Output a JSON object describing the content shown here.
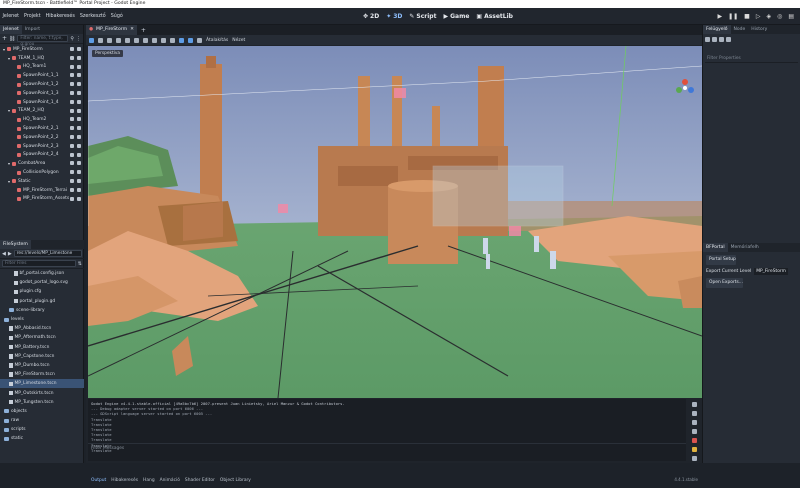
{
  "window": {
    "title": "MP_FireStorm.tscn - Battlefield™ Portal Project - Godot Engine"
  },
  "menu": {
    "items": [
      "Jelenet",
      "Projekt",
      "Hibakeresés",
      "Szerkesztő",
      "Súgó"
    ]
  },
  "main_buttons": {
    "b2d": "2D",
    "b3d": "3D",
    "script": "Script",
    "game": "Game",
    "assetlib": "AssetLib"
  },
  "left_dock": {
    "tabs": [
      "Jelenet",
      "Import"
    ],
    "filter_placeholder": "Filter: name, t:type, g:grou",
    "tree": [
      {
        "label": "MP_FireStorm",
        "depth": 0,
        "color": "#e06a6a"
      },
      {
        "label": "TEAM_1_HQ",
        "depth": 1,
        "color": "#e06a6a"
      },
      {
        "label": "HQ_Team1",
        "depth": 2,
        "color": "#e06a6a"
      },
      {
        "label": "SpawnPoint_1_1",
        "depth": 2,
        "color": "#e06a6a"
      },
      {
        "label": "SpawnPoint_1_2",
        "depth": 2,
        "color": "#e06a6a"
      },
      {
        "label": "SpawnPoint_1_3",
        "depth": 2,
        "color": "#e06a6a"
      },
      {
        "label": "SpawnPoint_1_4",
        "depth": 2,
        "color": "#e06a6a"
      },
      {
        "label": "TEAM_2_HQ",
        "depth": 1,
        "color": "#e06a6a"
      },
      {
        "label": "HQ_Team2",
        "depth": 2,
        "color": "#e06a6a"
      },
      {
        "label": "SpawnPoint_2_1",
        "depth": 2,
        "color": "#e06a6a"
      },
      {
        "label": "SpawnPoint_2_2",
        "depth": 2,
        "color": "#e06a6a"
      },
      {
        "label": "SpawnPoint_2_3",
        "depth": 2,
        "color": "#e06a6a"
      },
      {
        "label": "SpawnPoint_2_4",
        "depth": 2,
        "color": "#e06a6a"
      },
      {
        "label": "CombatArea",
        "depth": 1,
        "color": "#e06a6a"
      },
      {
        "label": "CollisionPolygon",
        "depth": 2,
        "color": "#e06a6a"
      },
      {
        "label": "Static",
        "depth": 1,
        "color": "#e06a6a"
      },
      {
        "label": "MP_FireStorm_Terrai",
        "depth": 2,
        "color": "#e06a6a"
      },
      {
        "label": "MP_FireStorm_Assets",
        "depth": 2,
        "color": "#e06a6a"
      }
    ],
    "filesystem_tab": "FileSystem",
    "path": "res://levels/MP_Limestone",
    "filter_files": "Filter Files",
    "files": [
      {
        "label": "bf_portal.config.json",
        "type": "file",
        "depth": 2,
        "sel": false
      },
      {
        "label": "godot_portal_logo.svg",
        "type": "file",
        "depth": 2,
        "sel": false
      },
      {
        "label": "plugin.cfg",
        "type": "file",
        "depth": 2,
        "sel": false
      },
      {
        "label": "portal_plugin.gd",
        "type": "file",
        "depth": 2,
        "sel": false
      },
      {
        "label": "scene-library",
        "type": "folder",
        "depth": 1,
        "sel": false
      },
      {
        "label": "levels",
        "type": "folder",
        "depth": 0,
        "sel": false
      },
      {
        "label": "MP_Abbasid.tscn",
        "type": "file",
        "depth": 1,
        "sel": false
      },
      {
        "label": "MP_Aftermath.tscn",
        "type": "file",
        "depth": 1,
        "sel": false
      },
      {
        "label": "MP_Battery.tscn",
        "type": "file",
        "depth": 1,
        "sel": false
      },
      {
        "label": "MP_Capstone.tscn",
        "type": "file",
        "depth": 1,
        "sel": false
      },
      {
        "label": "MP_Dumbo.tscn",
        "type": "file",
        "depth": 1,
        "sel": false
      },
      {
        "label": "MP_FireStorm.tscn",
        "type": "file",
        "depth": 1,
        "sel": false
      },
      {
        "label": "MP_Limestone.tscn",
        "type": "file",
        "depth": 1,
        "sel": true
      },
      {
        "label": "MP_Outskirts.tscn",
        "type": "file",
        "depth": 1,
        "sel": false
      },
      {
        "label": "MP_Tungsten.tscn",
        "type": "file",
        "depth": 1,
        "sel": false
      },
      {
        "label": "objects",
        "type": "folder",
        "depth": 0,
        "sel": false
      },
      {
        "label": "raw",
        "type": "folder",
        "depth": 0,
        "sel": false
      },
      {
        "label": "scripts",
        "type": "folder",
        "depth": 0,
        "sel": false
      },
      {
        "label": "static",
        "type": "folder",
        "depth": 0,
        "sel": false
      }
    ]
  },
  "center": {
    "scene_tab": "MP_FireStorm",
    "toolbar_labels": [
      "Átalakítás",
      "Nézet"
    ],
    "perspective": "Perspektíva",
    "console": [
      "Godot Engine v4.4.1.stable.official [49a5bc7b6] 2007-present Juan Linietsky, Ariel Manzur & Godot Contributors.",
      "--- Debug adapter server started on port 6006 ---",
      "--- GDScript language server started on port 6005 ---",
      "Translate",
      "Translate",
      "Translate",
      "Translate",
      "Translate",
      "Translate",
      "Translate"
    ],
    "filter_messages": "Filter Messages",
    "bottom_tabs": [
      "Output",
      "Hibakeresés",
      "Hang",
      "Animáció",
      "Shader Editor",
      "Object Library"
    ],
    "version": "4.4.1.stable"
  },
  "right_dock": {
    "tabs": [
      "Felügyelő",
      "Node",
      "History"
    ],
    "filter_properties": "Filter Properties",
    "portal_tabs": [
      "BFPortal",
      "Memóriafelh"
    ],
    "portal_setup": "Portal Setup",
    "export_current_label": "Export Current Level",
    "export_current_value": "MP_FireStorm",
    "open_exports": "Open Exports..."
  }
}
